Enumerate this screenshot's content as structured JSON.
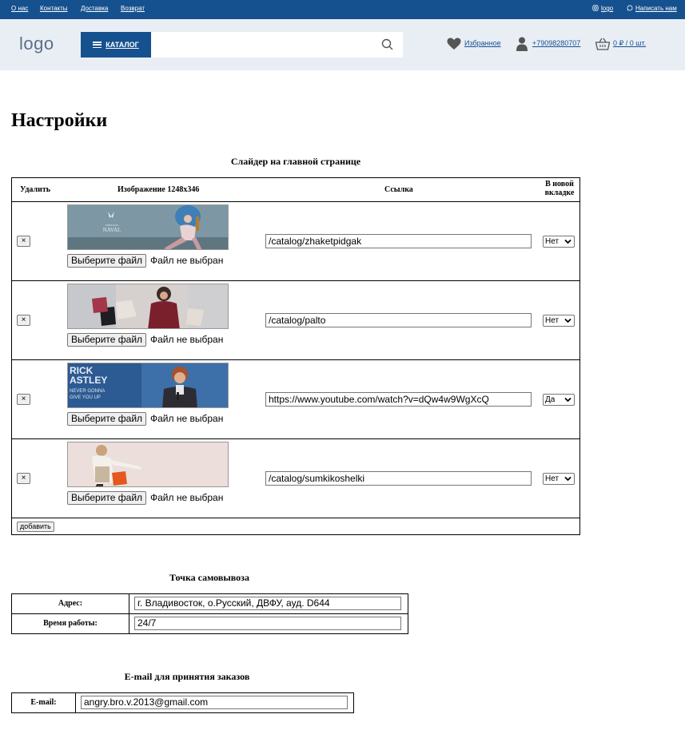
{
  "topbar": {
    "links": [
      "О нас",
      "Контакты",
      "Доставка",
      "Возврат"
    ],
    "instagram_label": "logo",
    "write_us_label": "Написать нам"
  },
  "header": {
    "logo": "logo",
    "catalog_label": "КАТАЛОГ",
    "search_value": "",
    "favorites_label": "Избранное",
    "phone_label": "+79098280707",
    "cart_label": "0 ₽ / 0 шт."
  },
  "page": {
    "title": "Настройки"
  },
  "slider": {
    "title": "Слайдер на главной странице",
    "columns": {
      "delete": "Удалить",
      "image": "Изображение 1248x346",
      "link": "Ссылка",
      "new_tab": "В новой вкладке"
    },
    "file_button_label": "Выберите файл",
    "file_status": "Файл не выбран",
    "delete_glyph": "×",
    "rows": [
      {
        "link": "/catalog/zhaketpidgak",
        "new_tab": "Нет",
        "image_desc": "fashion-woman-fur"
      },
      {
        "link": "/catalog/palto",
        "new_tab": "Нет",
        "image_desc": "woman-shopping-bags"
      },
      {
        "link": "https://www.youtube.com/watch?v=dQw4w9WgXcQ",
        "new_tab": "Да",
        "image_desc": "rick-astley",
        "image_text": [
          "RICK",
          "ASTLEY",
          "NEVER GONNA",
          "GIVE YOU UP"
        ]
      },
      {
        "link": "/catalog/sumkikoshelki",
        "new_tab": "Нет",
        "image_desc": "woman-orange-bag"
      }
    ],
    "add_button_label": "добавить",
    "banner_brand": [
      "FORTUNA",
      "NAVAL"
    ]
  },
  "pickup": {
    "title": "Точка самовывоза",
    "address_label": "Адрес:",
    "address_value": "г. Владивосток, о.Русский, ДВФУ, ауд. D644",
    "hours_label": "Время работы:",
    "hours_value": "24/7"
  },
  "email": {
    "title": "E-mail для принятия заказов",
    "label": "E-mail:",
    "value": "angry.bro.v.2013@gmail.com"
  },
  "colors": {
    "brand": "#16518f",
    "header_bg": "#e9eef5"
  }
}
